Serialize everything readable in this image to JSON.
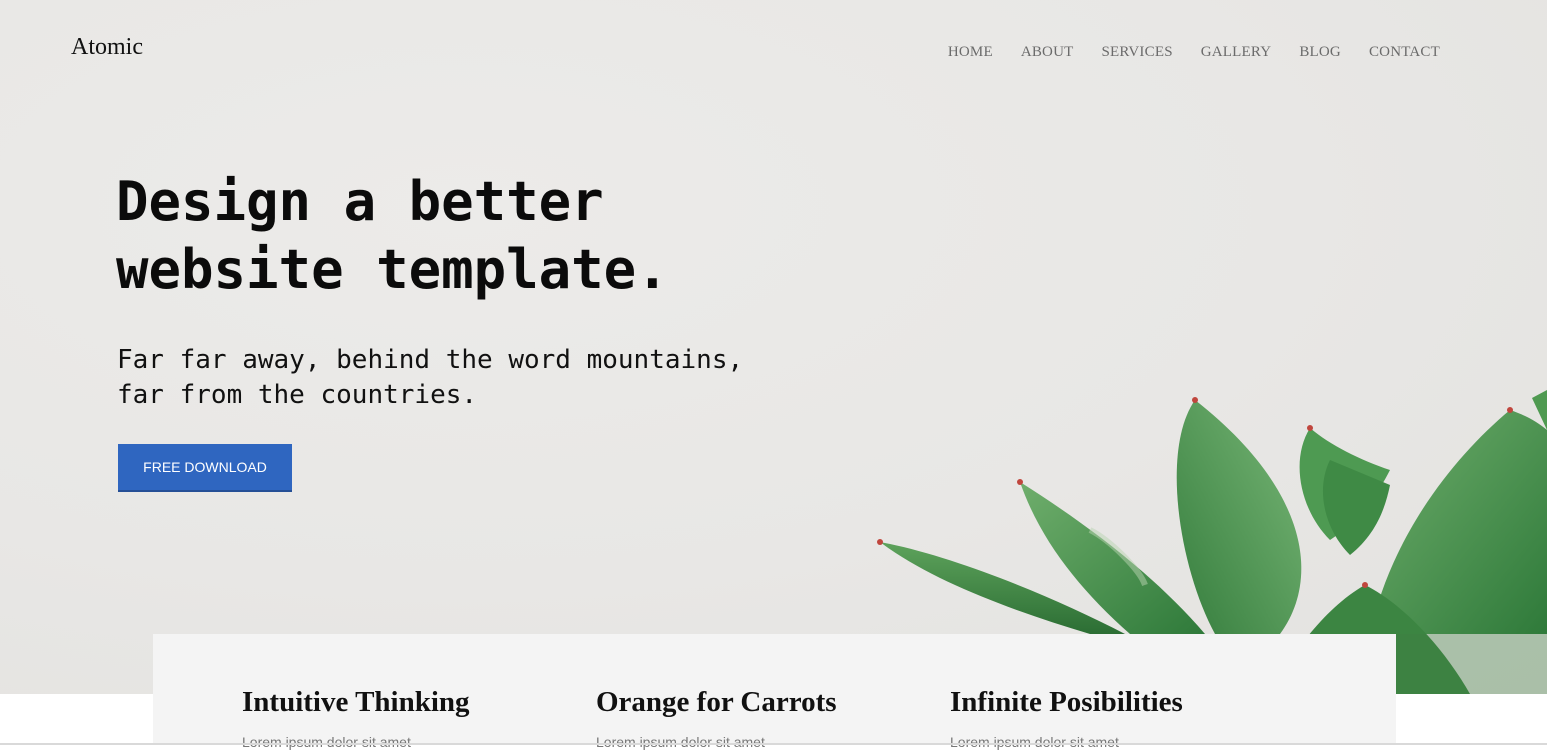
{
  "brand": {
    "name": "Atomic"
  },
  "nav": {
    "items": [
      {
        "label": "HOME",
        "id": "home"
      },
      {
        "label": "ABOUT",
        "id": "about"
      },
      {
        "label": "SERVICES",
        "id": "services"
      },
      {
        "label": "GALLERY",
        "id": "gallery"
      },
      {
        "label": "BLOG",
        "id": "blog"
      },
      {
        "label": "CONTACT",
        "id": "contact"
      }
    ]
  },
  "hero": {
    "headline_line1": "Design a better",
    "headline_line2": "website template.",
    "sub_line1": "Far far away, behind the word mountains,",
    "sub_line2": "far from the countries.",
    "cta_label": "FREE DOWNLOAD"
  },
  "features": [
    {
      "title": "Intuitive Thinking",
      "text": "Lorem ipsum dolor sit amet"
    },
    {
      "title": "Orange for Carrots",
      "text": "Lorem ipsum dolor sit amet"
    },
    {
      "title": "Infinite Posibilities",
      "text": "Lorem ipsum dolor sit amet"
    }
  ],
  "colors": {
    "accent": "#2f66c0",
    "hero_bg": "#e8e7e5",
    "feature_bg": "#f4f4f4",
    "plant_green": "#3f8a45"
  },
  "icons": {
    "hero_image": "succulent-plant-image"
  }
}
